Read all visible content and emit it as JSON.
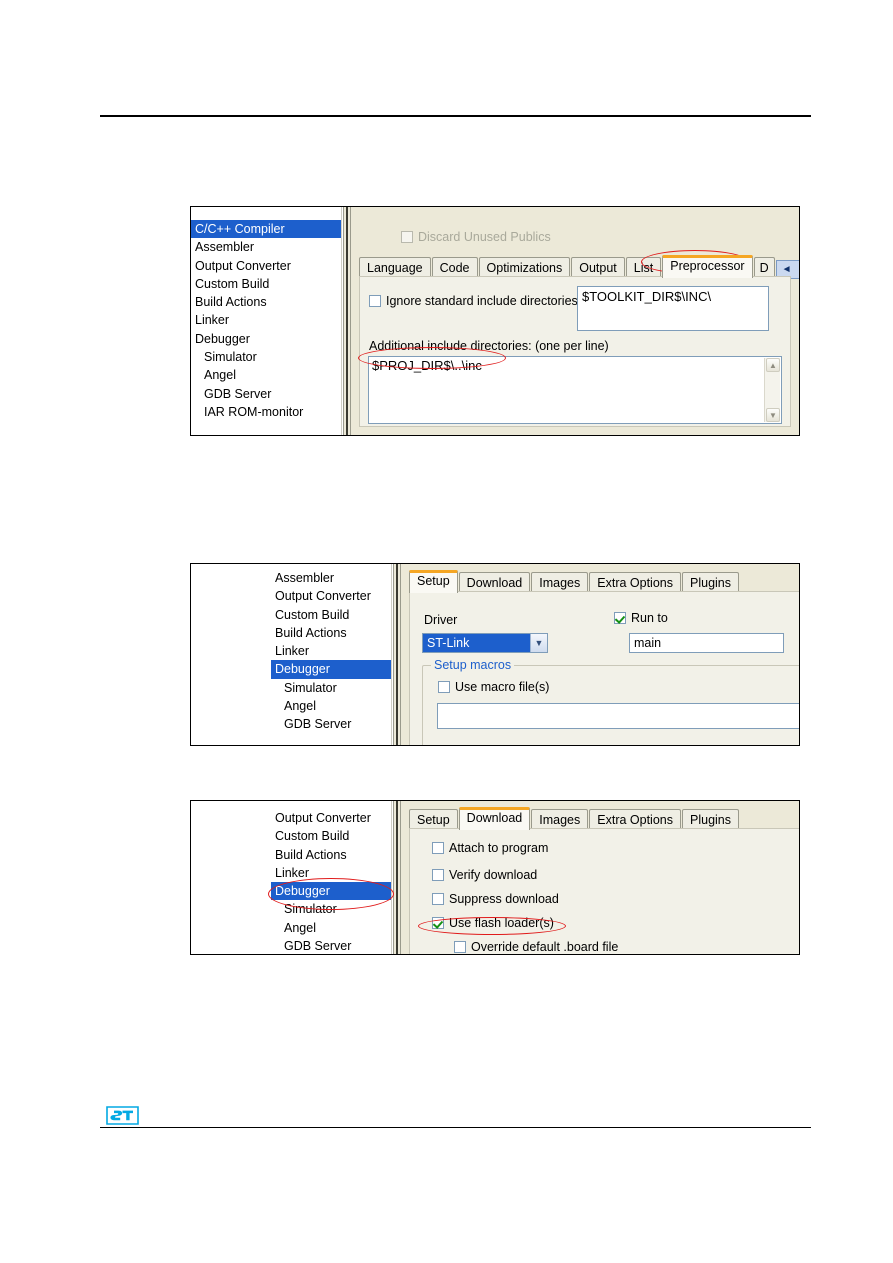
{
  "document": {
    "logo_alt": "ST logo"
  },
  "figure1": {
    "name": "cpp-compiler-preprocessor-dialog",
    "categories": [
      {
        "label": "C/C++ Compiler",
        "selected": true,
        "indent": false
      },
      {
        "label": "Assembler",
        "selected": false,
        "indent": false
      },
      {
        "label": "Output Converter",
        "selected": false,
        "indent": false
      },
      {
        "label": "Custom Build",
        "selected": false,
        "indent": false
      },
      {
        "label": "Build Actions",
        "selected": false,
        "indent": false
      },
      {
        "label": "Linker",
        "selected": false,
        "indent": false
      },
      {
        "label": "Debugger",
        "selected": false,
        "indent": false
      },
      {
        "label": "Simulator",
        "selected": false,
        "indent": true
      },
      {
        "label": "Angel",
        "selected": false,
        "indent": true
      },
      {
        "label": "GDB Server",
        "selected": false,
        "indent": true
      },
      {
        "label": "IAR ROM-monitor",
        "selected": false,
        "indent": true
      }
    ],
    "discard_unused_publics": {
      "label": "Discard Unused Publics",
      "checked": false,
      "enabled": false
    },
    "tabs": [
      {
        "label": "Language",
        "active": false
      },
      {
        "label": "Code",
        "active": false
      },
      {
        "label": "Optimizations",
        "active": false
      },
      {
        "label": "Output",
        "active": false
      },
      {
        "label": "List",
        "active": false
      },
      {
        "label": "Preprocessor",
        "active": true
      },
      {
        "label": "D",
        "active": false
      }
    ],
    "tab_nav": {
      "prev": "◄",
      "next": "►"
    },
    "ignore_standard_include": {
      "label": "Ignore standard include directories",
      "checked": false
    },
    "toolkit_dir_value": "$TOOLKIT_DIR$\\INC\\",
    "additional_include_label": "Additional include directories: (one per line)",
    "additional_include_value": "$PROJ_DIR$\\..\\inc",
    "scroll_up_glyph": "▲",
    "scroll_down_glyph": "▼",
    "annotations": {
      "preprocessor_tab_highlight": "ellipse-preprocessor-tab",
      "proj_dir_highlight": "ellipse-proj-dir"
    }
  },
  "figure2": {
    "name": "debugger-setup-dialog",
    "categories": [
      {
        "label": "Assembler",
        "selected": false,
        "indent": false
      },
      {
        "label": "Output Converter",
        "selected": false,
        "indent": false
      },
      {
        "label": "Custom Build",
        "selected": false,
        "indent": false
      },
      {
        "label": "Build Actions",
        "selected": false,
        "indent": false
      },
      {
        "label": "Linker",
        "selected": false,
        "indent": false
      },
      {
        "label": "Debugger",
        "selected": true,
        "indent": false
      },
      {
        "label": "Simulator",
        "selected": false,
        "indent": true
      },
      {
        "label": "Angel",
        "selected": false,
        "indent": true
      },
      {
        "label": "GDB Server",
        "selected": false,
        "indent": true
      }
    ],
    "tabs": [
      {
        "label": "Setup",
        "active": true
      },
      {
        "label": "Download",
        "active": false
      },
      {
        "label": "Images",
        "active": false
      },
      {
        "label": "Extra Options",
        "active": false
      },
      {
        "label": "Plugins",
        "active": false
      }
    ],
    "driver_label": "Driver",
    "driver_value": "ST-Link",
    "driver_arrow": "▼",
    "run_to": {
      "label": "Run to",
      "checked": true
    },
    "run_to_value": "main",
    "setup_macros_title": "Setup macros",
    "use_macro_file": {
      "label": "Use macro file(s)",
      "checked": false
    }
  },
  "figure3": {
    "name": "debugger-download-dialog",
    "categories": [
      {
        "label": "Output Converter",
        "selected": false,
        "indent": false
      },
      {
        "label": "Custom Build",
        "selected": false,
        "indent": false
      },
      {
        "label": "Build Actions",
        "selected": false,
        "indent": false
      },
      {
        "label": "Linker",
        "selected": false,
        "indent": false
      },
      {
        "label": "Debugger",
        "selected": true,
        "indent": false
      },
      {
        "label": "Simulator",
        "selected": false,
        "indent": true
      },
      {
        "label": "Angel",
        "selected": false,
        "indent": true
      },
      {
        "label": "GDB Server",
        "selected": false,
        "indent": true
      }
    ],
    "tabs": [
      {
        "label": "Setup",
        "active": false
      },
      {
        "label": "Download",
        "active": true
      },
      {
        "label": "Images",
        "active": false
      },
      {
        "label": "Extra Options",
        "active": false
      },
      {
        "label": "Plugins",
        "active": false
      }
    ],
    "options": [
      {
        "label": "Attach to program",
        "checked": false,
        "indent": false
      },
      {
        "label": "Verify download",
        "checked": false,
        "indent": false
      },
      {
        "label": "Suppress download",
        "checked": false,
        "indent": false
      },
      {
        "label": "Use flash loader(s)",
        "checked": true,
        "indent": false
      },
      {
        "label": "Override default .board file",
        "checked": false,
        "indent": true
      }
    ],
    "annotations": {
      "debugger_highlight": "ellipse-debugger-item",
      "flash_loader_highlight": "ellipse-use-flash-loader"
    }
  },
  "colors": {
    "selection_blue": "#1d5fcc",
    "annotation_red": "#e01b1b",
    "tab_accent_orange": "#f5a623",
    "dialog_bg": "#ece9d8",
    "st_brand_blue": "#03a9e3"
  }
}
